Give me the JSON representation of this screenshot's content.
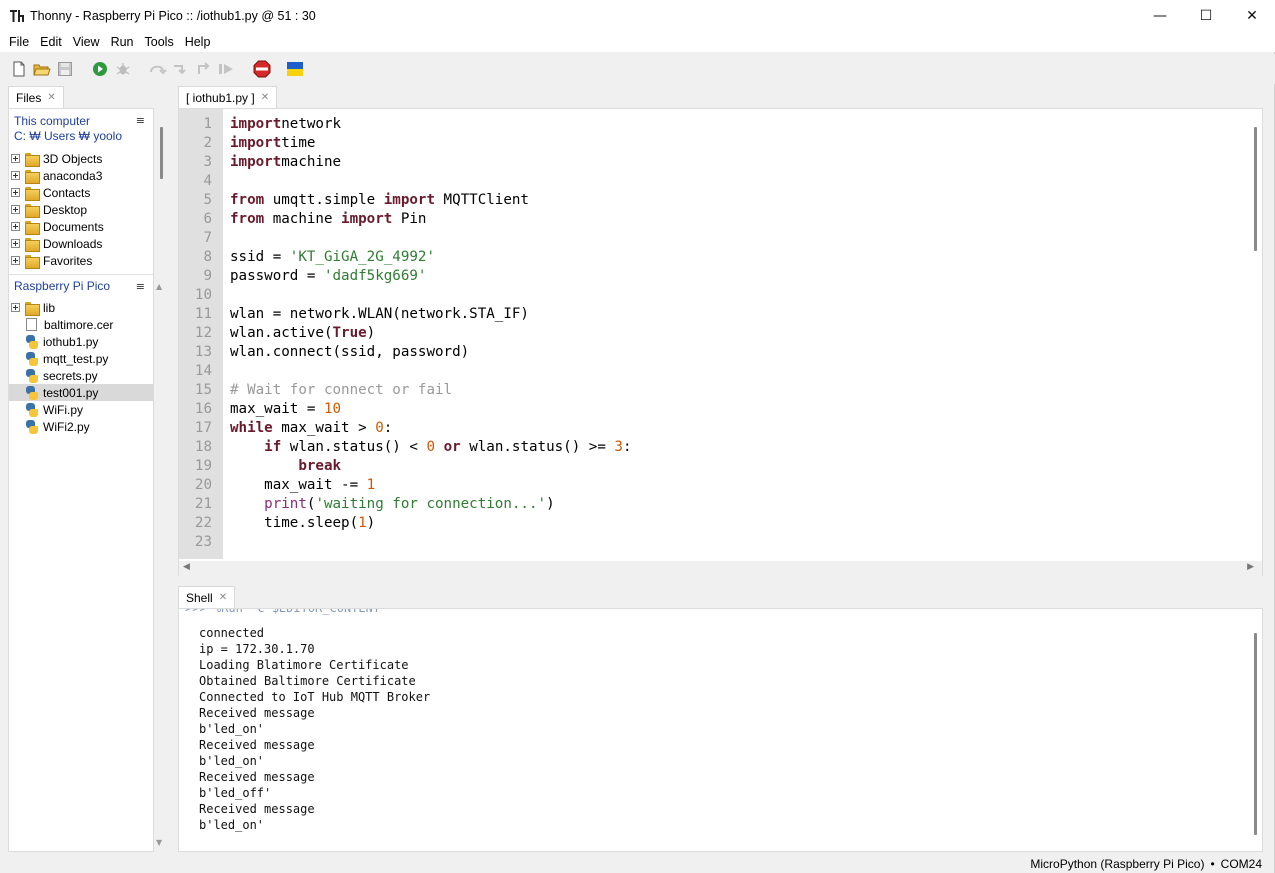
{
  "window": {
    "title": "Thonny  -  Raspberry Pi Pico :: /iothub1.py  @  51 : 30",
    "minimize": "—",
    "maximize": "☐",
    "close": "✕"
  },
  "menu": [
    "File",
    "Edit",
    "View",
    "Run",
    "Tools",
    "Help"
  ],
  "toolbar": {
    "icons": [
      "new-file-icon",
      "open-folder-icon",
      "save-icon",
      "run-icon",
      "debug-icon",
      "step-over-icon",
      "step-into-icon",
      "step-out-icon",
      "resume-icon",
      "stop-icon",
      "ukraine-flag-icon"
    ]
  },
  "files_panel": {
    "tab_label": "Files",
    "tab_close": "✕",
    "menu_glyph": "≡",
    "computer_label": "This computer",
    "computer_path": "C: ₩ Users ₩ yoolo",
    "computer_items": [
      "3D Objects",
      "anaconda3",
      "Contacts",
      "Desktop",
      "Documents",
      "Downloads",
      "Favorites"
    ],
    "pico_label": "Raspberry Pi Pico",
    "pico_items": [
      {
        "name": "lib",
        "type": "folder"
      },
      {
        "name": "baltimore.cer",
        "type": "file"
      },
      {
        "name": "iothub1.py",
        "type": "py"
      },
      {
        "name": "mqtt_test.py",
        "type": "py"
      },
      {
        "name": "secrets.py",
        "type": "py"
      },
      {
        "name": "test001.py",
        "type": "py",
        "selected": true
      },
      {
        "name": "WiFi.py",
        "type": "py"
      },
      {
        "name": "WiFi2.py",
        "type": "py"
      }
    ]
  },
  "editor": {
    "tab_label": "[ iothub1.py ]",
    "tab_close": "✕",
    "line_numbers": [
      "1",
      "2",
      "3",
      "4",
      "5",
      "6",
      "7",
      "8",
      "9",
      "10",
      "11",
      "12",
      "13",
      "14",
      "15",
      "16",
      "17",
      "18",
      "19",
      "20",
      "21",
      "22",
      "23"
    ],
    "lines": [
      [
        [
          "kw",
          "import"
        ],
        [
          "",
          "network"
        ]
      ],
      [
        [
          "kw",
          "import"
        ],
        [
          "",
          "time"
        ]
      ],
      [
        [
          "kw",
          "import"
        ],
        [
          "",
          "machine"
        ]
      ],
      [],
      [
        [
          "kw",
          "from"
        ],
        [
          "",
          " umqtt.simple "
        ],
        [
          "kw",
          "import"
        ],
        [
          "",
          " MQTTClient"
        ]
      ],
      [
        [
          "kw",
          "from"
        ],
        [
          "",
          " machine "
        ],
        [
          "kw",
          "import"
        ],
        [
          "",
          " Pin"
        ]
      ],
      [],
      [
        [
          "",
          "ssid = "
        ],
        [
          "st",
          "'KT_GiGA_2G_4992'"
        ]
      ],
      [
        [
          "",
          "password = "
        ],
        [
          "st",
          "'dadf5kg669'"
        ]
      ],
      [],
      [
        [
          "",
          "wlan = network.WLAN(network.STA_IF)"
        ]
      ],
      [
        [
          "",
          "wlan.active("
        ],
        [
          "kw",
          "True"
        ],
        [
          "",
          ")"
        ]
      ],
      [
        [
          "",
          "wlan.connect(ssid, password)"
        ]
      ],
      [],
      [
        [
          "cm",
          "# Wait for connect or fail"
        ]
      ],
      [
        [
          "",
          "max_wait = "
        ],
        [
          "nm",
          "10"
        ]
      ],
      [
        [
          "kw",
          "while"
        ],
        [
          "",
          " max_wait > "
        ],
        [
          "nm",
          "0"
        ],
        [
          "",
          ":"
        ]
      ],
      [
        [
          "",
          "    "
        ],
        [
          "kw",
          "if"
        ],
        [
          "",
          " wlan.status() < "
        ],
        [
          "nm",
          "0"
        ],
        [
          "",
          " "
        ],
        [
          "kw",
          "or"
        ],
        [
          "",
          " wlan.status() >= "
        ],
        [
          "nm",
          "3"
        ],
        [
          "",
          ":"
        ]
      ],
      [
        [
          "",
          "        "
        ],
        [
          "kw",
          "break"
        ]
      ],
      [
        [
          "",
          "    max_wait -= "
        ],
        [
          "nm",
          "1"
        ]
      ],
      [
        [
          "",
          "    "
        ],
        [
          "bi",
          "print"
        ],
        [
          "",
          "("
        ],
        [
          "st",
          "'waiting for connection...'"
        ],
        [
          "",
          ")"
        ]
      ],
      [
        [
          "",
          "    time.sleep("
        ],
        [
          "nm",
          "1"
        ],
        [
          "",
          ")"
        ]
      ],
      []
    ]
  },
  "shell": {
    "tab_label": "Shell",
    "tab_close": "✕",
    "partial_line": ">>> %Run -c $EDITOR_CONTENT",
    "lines": [
      "connected",
      "ip = 172.30.1.70",
      "Loading Blatimore Certificate",
      "Obtained Baltimore Certificate",
      "Connected to IoT Hub MQTT Broker",
      "Received message",
      "b'led_on'",
      "Received message",
      "b'led_on'",
      "Received message",
      "b'led_off'",
      "Received message",
      "b'led_on'"
    ]
  },
  "status": {
    "interpreter": "MicroPython (Raspberry Pi Pico)",
    "separator": "•",
    "port": "COM24"
  }
}
